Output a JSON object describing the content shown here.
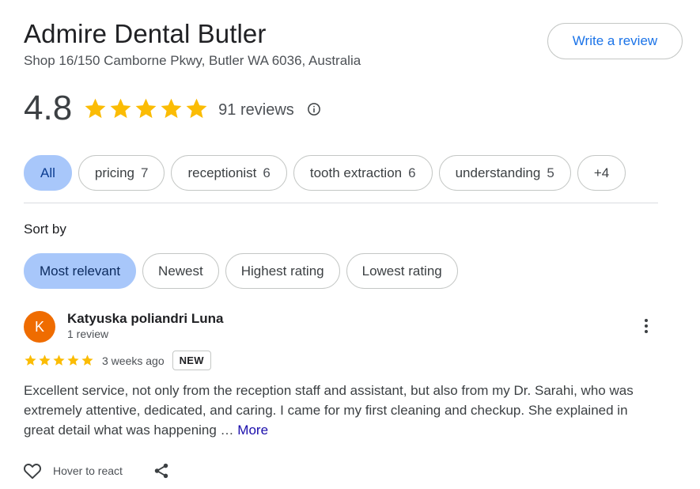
{
  "business": {
    "name": "Admire Dental Butler",
    "address": "Shop 16/150 Camborne Pkwy, Butler WA 6036, Australia",
    "write_review_label": "Write a review"
  },
  "rating": {
    "value": "4.8",
    "stars": 5,
    "reviews_label": "91 reviews",
    "info_icon": "info-icon"
  },
  "topics": [
    {
      "label": "All",
      "count": ""
    },
    {
      "label": "pricing",
      "count": "7"
    },
    {
      "label": "receptionist",
      "count": "6"
    },
    {
      "label": "tooth extraction",
      "count": "6"
    },
    {
      "label": "understanding",
      "count": "5"
    },
    {
      "label": "+4",
      "count": ""
    }
  ],
  "sort": {
    "label": "Sort by",
    "options": [
      "Most relevant",
      "Newest",
      "Highest rating",
      "Lowest rating"
    ],
    "selected": "Most relevant"
  },
  "review": {
    "avatar_letter": "K",
    "avatar_color": "#ef6c00",
    "name": "Katyuska poliandri Luna",
    "meta": "1 review",
    "stars": 5,
    "date": "3 weeks ago",
    "badge": "NEW",
    "text": "Excellent service, not only from the reception staff and assistant, but also from my Dr. Sarahi, who was extremely attentive, dedicated, and caring. I came for my first cleaning and checkup. She explained in great detail what was happening …",
    "more_label": "More",
    "react_label": "Hover to react"
  },
  "colors": {
    "star": "#fbbc04",
    "accent_chip": "#a8c7fa",
    "link": "#1a73e8"
  }
}
